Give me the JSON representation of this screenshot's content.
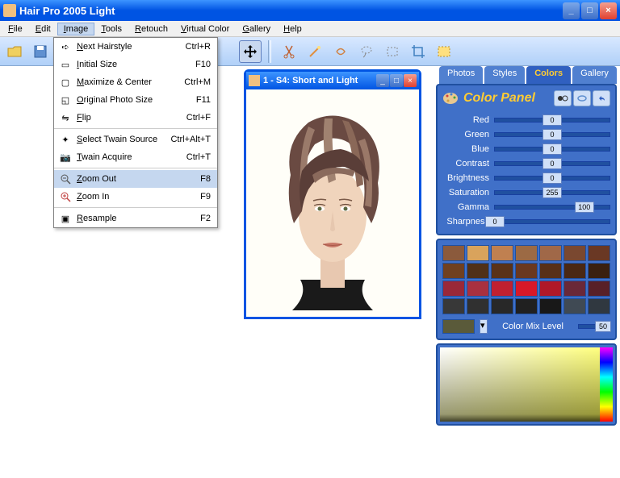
{
  "window": {
    "title": "Hair Pro 2005  Light"
  },
  "menubar": {
    "items": [
      "File",
      "Edit",
      "Image",
      "Tools",
      "Retouch",
      "Virtual Color",
      "Gallery",
      "Help"
    ],
    "active_index": 2
  },
  "dropdown": {
    "items": [
      {
        "label": "Next Hairstyle",
        "shortcut": "Ctrl+R",
        "icon": "next-icon"
      },
      {
        "label": "Initial Size",
        "shortcut": "F10",
        "icon": "initial-size-icon"
      },
      {
        "label": "Maximize & Center",
        "shortcut": "Ctrl+M",
        "icon": "maximize-icon"
      },
      {
        "label": "Original Photo Size",
        "shortcut": "F11",
        "icon": "original-size-icon"
      },
      {
        "label": "Flip",
        "shortcut": "Ctrl+F",
        "icon": "flip-icon"
      },
      {
        "sep": true
      },
      {
        "label": "Select Twain Source",
        "shortcut": "Ctrl+Alt+T",
        "icon": "twain-src-icon"
      },
      {
        "label": "Twain Acquire",
        "shortcut": "Ctrl+T",
        "icon": "camera-icon"
      },
      {
        "sep": true
      },
      {
        "label": "Zoom Out",
        "shortcut": "F8",
        "icon": "zoom-out-icon",
        "highlighted": true
      },
      {
        "label": "Zoom In",
        "shortcut": "F9",
        "icon": "zoom-in-icon"
      },
      {
        "sep": true
      },
      {
        "label": "Resample",
        "shortcut": "F2",
        "icon": "resample-icon"
      }
    ]
  },
  "child_window": {
    "title": "1 - S4: Short and Light"
  },
  "tabs": {
    "items": [
      "Photos",
      "Styles",
      "Colors",
      "Gallery"
    ],
    "active_index": 2
  },
  "color_panel": {
    "title": "Color Panel",
    "sliders": [
      {
        "label": "Red",
        "value": 0,
        "pos": 50
      },
      {
        "label": "Green",
        "value": 0,
        "pos": 50
      },
      {
        "label": "Blue",
        "value": 0,
        "pos": 50
      },
      {
        "label": "Contrast",
        "value": 0,
        "pos": 50
      },
      {
        "label": "Brightness",
        "value": 0,
        "pos": 50
      },
      {
        "label": "Saturation",
        "value": 255,
        "pos": 50
      },
      {
        "label": "Gamma",
        "value": 100,
        "pos": 78
      },
      {
        "label": "Sharpness",
        "value": 0,
        "pos": 0
      }
    ],
    "swatches": [
      "#8b5a3c",
      "#d9a35c",
      "#c08050",
      "#9c6a44",
      "#a06848",
      "#7a4830",
      "#6a3824",
      "#704020",
      "#503018",
      "#5a3218",
      "#6a3820",
      "#583018",
      "#4a2814",
      "#3a2010",
      "#9a2838",
      "#a83040",
      "#c02030",
      "#d81828",
      "#b01828",
      "#6a2838",
      "#582028",
      "#383838",
      "#303030",
      "#282828",
      "#202020",
      "#181818",
      "#404a54",
      "#303840"
    ],
    "mix_label": "Color Mix Level",
    "mix_value": 50,
    "current_swatch": "#5a5a3a"
  }
}
